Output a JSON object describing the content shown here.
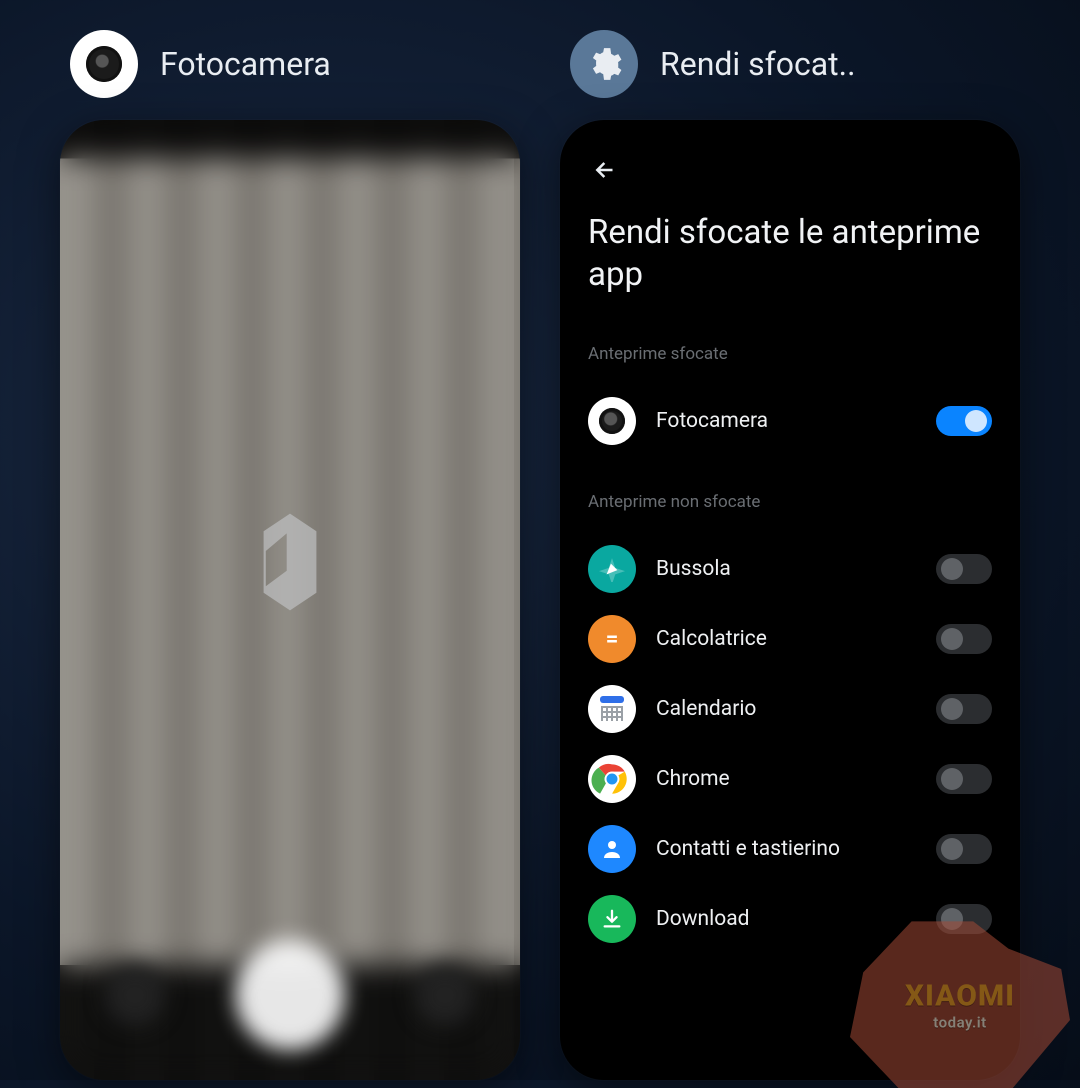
{
  "recents": {
    "left": {
      "title": "Fotocamera",
      "icon": "camera-icon"
    },
    "right": {
      "title": "Rendi sfocat..",
      "icon": "gear-icon"
    }
  },
  "settings": {
    "back_label": "Indietro",
    "page_title": "Rendi sfocate le anteprime app",
    "sections": {
      "blurred_label": "Anteprime sfocate",
      "not_blurred_label": "Anteprime non sfocate"
    },
    "apps_blurred": [
      {
        "name": "Fotocamera",
        "icon": "camera",
        "on": true
      }
    ],
    "apps_clear": [
      {
        "name": "Bussola",
        "icon": "compass",
        "on": false
      },
      {
        "name": "Calcolatrice",
        "icon": "calc",
        "on": false
      },
      {
        "name": "Calendario",
        "icon": "calendar",
        "on": false
      },
      {
        "name": "Chrome",
        "icon": "chrome",
        "on": false
      },
      {
        "name": "Contatti e tastierino",
        "icon": "contacts",
        "on": false
      },
      {
        "name": "Download",
        "icon": "download",
        "on": false
      }
    ]
  },
  "watermark": {
    "brand": "XIAOMI",
    "site": "today.it"
  }
}
